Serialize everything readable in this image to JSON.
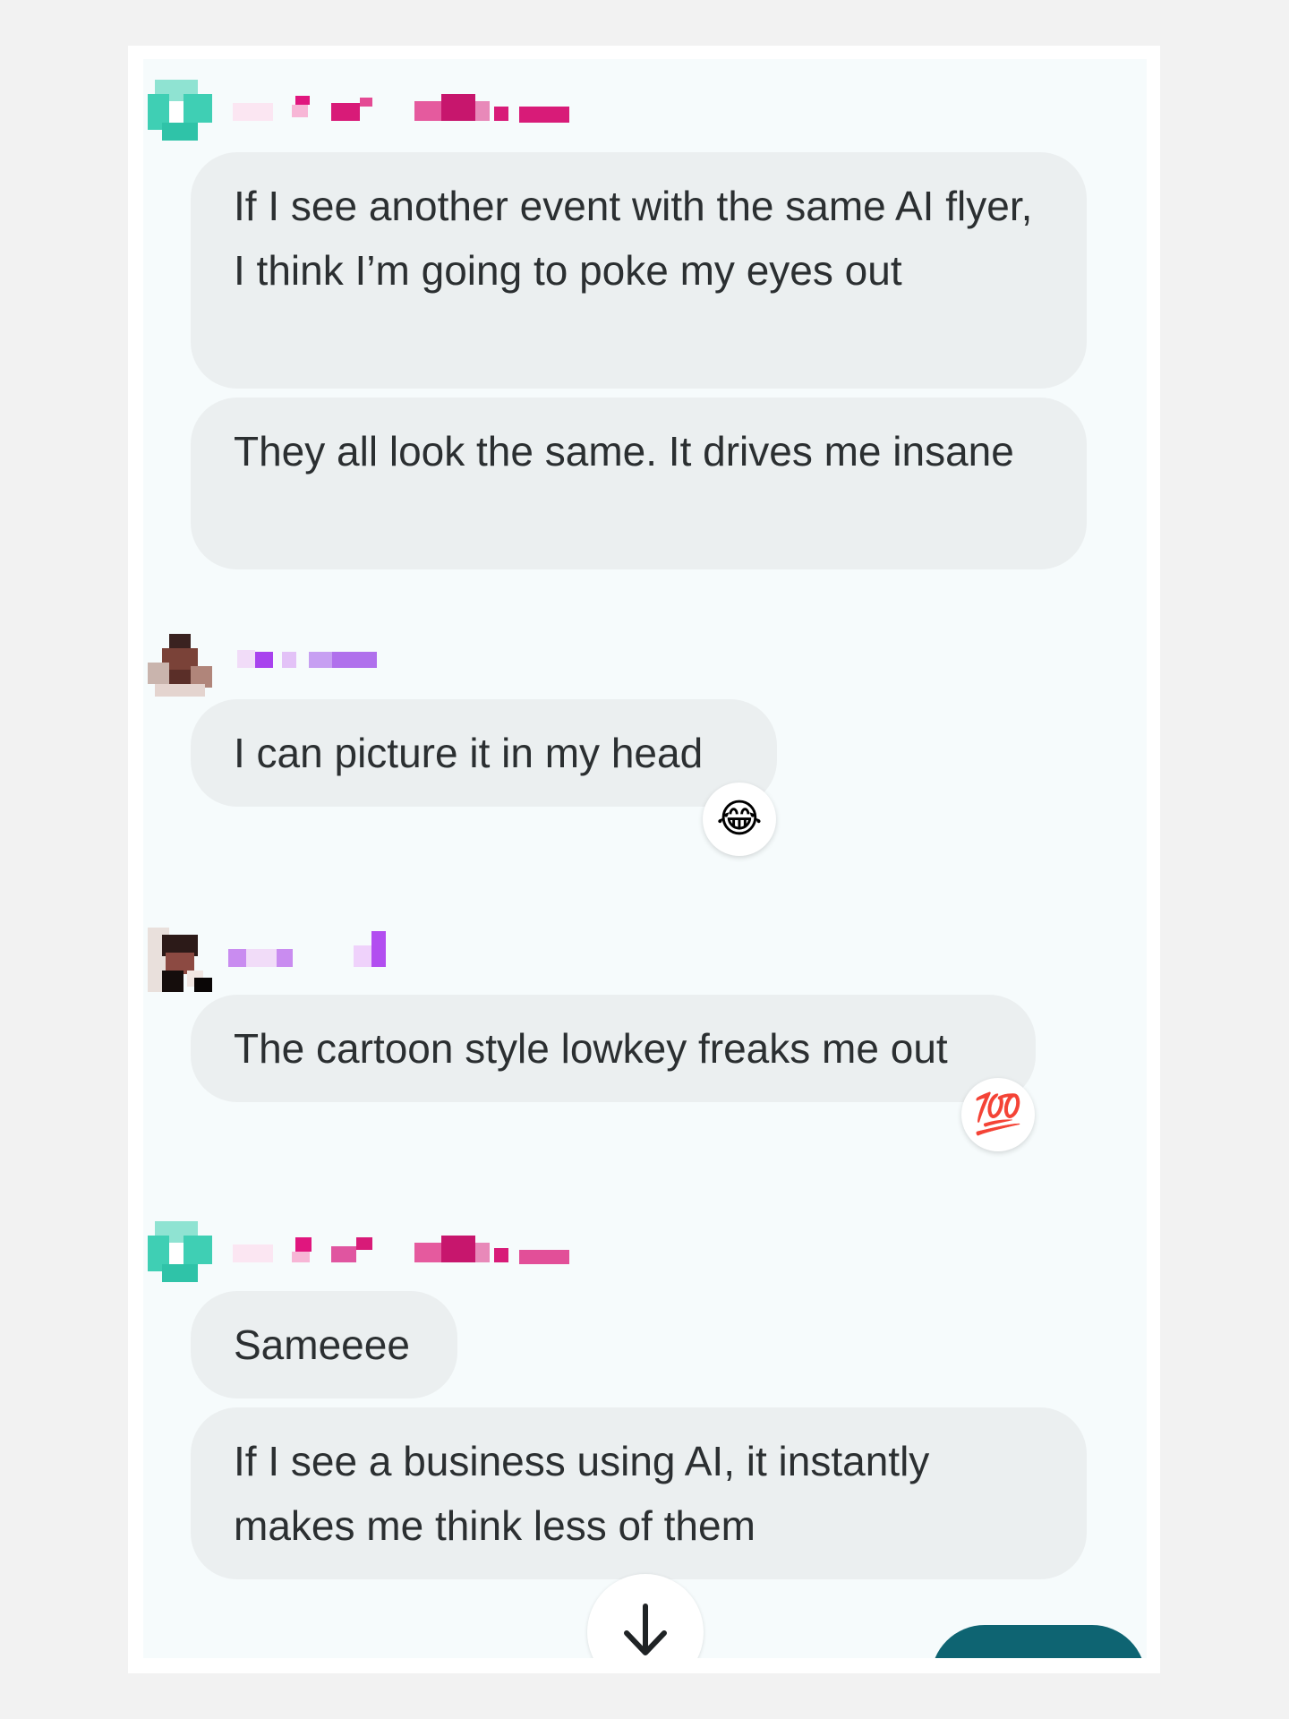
{
  "chat": {
    "groups": [
      {
        "messages": [
          "If I see another event with the same AI flyer, I think I’m going to poke my eyes out",
          "They all look the same. It drives me insane"
        ]
      },
      {
        "messages": [
          "I can picture it in my head"
        ],
        "reaction": "😂"
      },
      {
        "messages": [
          "The cartoon style lowkey freaks me out"
        ],
        "reaction": "💯"
      },
      {
        "messages": [
          "Sameeee",
          "If I see a business using AI, it instantly makes me think less of them"
        ]
      }
    ],
    "scroll_button_icon": "arrow-down-icon"
  },
  "colors": {
    "screen_background": "#f6fbfc",
    "bubble_background": "#ebeff0",
    "text": "#2b2f31",
    "fab": "#0e6472"
  }
}
